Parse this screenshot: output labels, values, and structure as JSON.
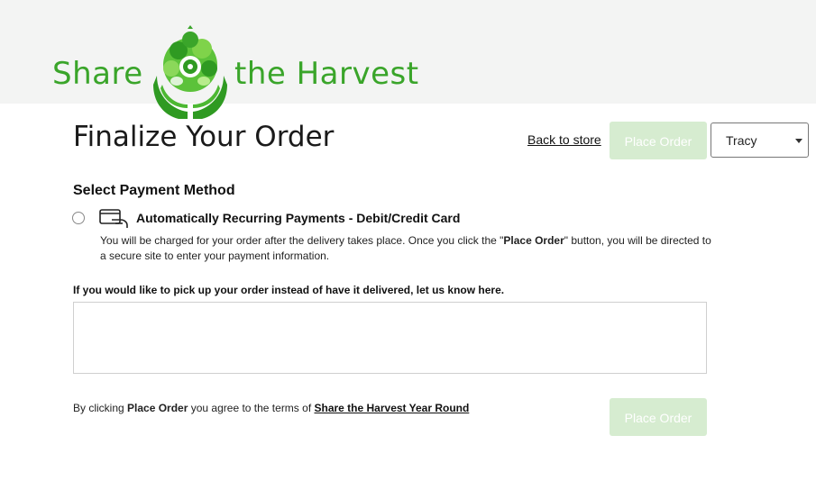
{
  "header": {
    "logo_left": "Share",
    "logo_right": "the Harvest"
  },
  "main": {
    "title": "Finalize Your Order",
    "back_link": "Back to store",
    "place_order_top": "Place Order",
    "user_select": {
      "selected": "Tracy"
    },
    "payment": {
      "section_title": "Select Payment Method",
      "option_label": "Automatically Recurring Payments - Debit/Credit Card",
      "desc_before": "You will be charged for your order after the delivery takes place. Once you click the \"",
      "desc_bold": "Place Order",
      "desc_after": "\" button, you will be directed to a secure site to enter your payment information."
    },
    "pickup": {
      "label": "If you would like to pick up your order instead of have it delivered, let us know here.",
      "value": ""
    },
    "terms": {
      "prefix": "By clicking ",
      "bold": "Place Order",
      "middle": " you agree to the terms of ",
      "link": "Share the Harvest Year Round"
    },
    "place_order_bottom": "Place Order"
  },
  "colors": {
    "brand_green": "#3aa52a",
    "button_disabled": "#d6ecd0",
    "header_bg": "#f3f4f3"
  }
}
